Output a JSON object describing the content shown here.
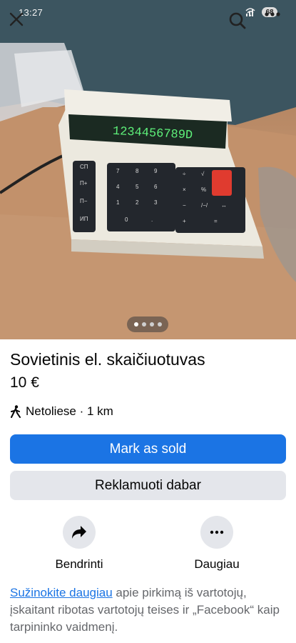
{
  "status_bar": {
    "time": "13:27",
    "battery": "68"
  },
  "photo": {
    "description_icon": "calculator-photo",
    "display_digits": "1234456789D",
    "carousel": {
      "count": 4,
      "active": 0
    }
  },
  "listing": {
    "title": "Sovietinis el. skaičiuotuvas",
    "price": "10 €",
    "location": "Netoliese · 1 km"
  },
  "buttons": {
    "mark_sold": "Mark as sold",
    "promote": "Reklamuoti dabar"
  },
  "actions": {
    "share": "Bendrinti",
    "more": "Daugiau"
  },
  "info": {
    "link": "Sužinokite daugiau",
    "text": " apie pirkimą iš vartotojų, įskaitant ribotas vartotojų teises ir „Facebook“ kaip tarpininko vaidmenį."
  },
  "colors": {
    "accent": "#1b74e4",
    "secondary": "#e4e6eb"
  }
}
